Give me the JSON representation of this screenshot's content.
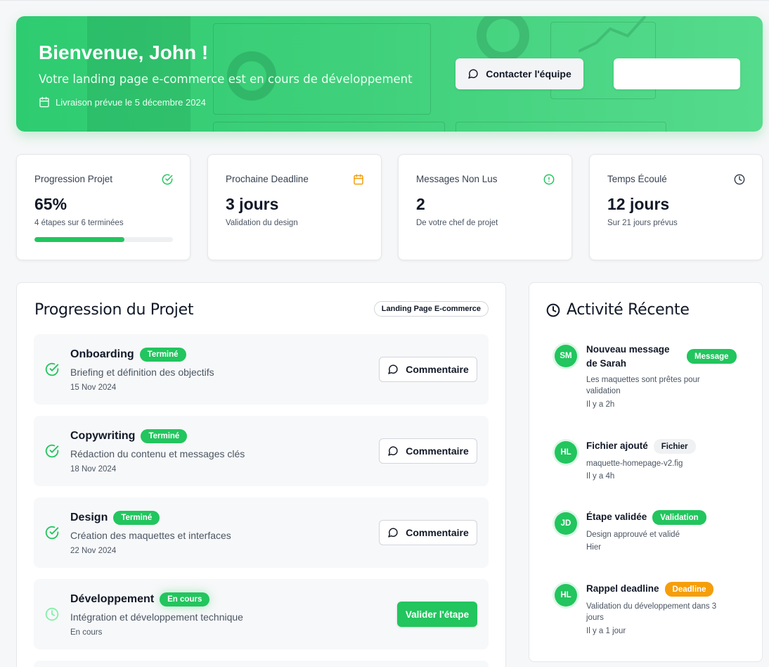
{
  "hero": {
    "title": "Bienvenue, John !",
    "subtitle": "Votre landing page e-commerce est en cours de développement",
    "delivery": "Livraison prévue le 5 décembre 2024",
    "contact_label": "Contacter l'équipe",
    "secondary_label": ""
  },
  "stats": [
    {
      "title": "Progression Projet",
      "value": "65%",
      "desc": "4 étapes sur 6 terminées",
      "icon": "check-circle-icon",
      "color": "#22c55e",
      "progress": 0.65
    },
    {
      "title": "Prochaine Deadline",
      "value": "3 jours",
      "desc": "Validation du design",
      "icon": "calendar-icon",
      "color": "#f59e0b"
    },
    {
      "title": "Messages Non Lus",
      "value": "2",
      "desc": "De votre chef de projet",
      "icon": "alert-circle-icon",
      "color": "#22c55e"
    },
    {
      "title": "Temps Écoulé",
      "value": "12 jours",
      "desc": "Sur 21 jours prévus",
      "icon": "clock-icon",
      "color": "#374151"
    }
  ],
  "project": {
    "title": "Progression du Projet",
    "tag": "Landing Page E-commerce",
    "steps": [
      {
        "name": "Onboarding",
        "status": "Terminé",
        "desc": "Briefing et définition des objectifs",
        "date": "15 Nov 2024",
        "action": "Commentaire"
      },
      {
        "name": "Copywriting",
        "status": "Terminé",
        "desc": "Rédaction du contenu et messages clés",
        "date": "18 Nov 2024",
        "action": "Commentaire"
      },
      {
        "name": "Design",
        "status": "Terminé",
        "desc": "Création des maquettes et interfaces",
        "date": "22 Nov 2024",
        "action": "Commentaire"
      },
      {
        "name": "Développement",
        "status": "En cours",
        "desc": "Intégration et développement technique",
        "date": "En cours",
        "action": "Valider l'étape"
      }
    ]
  },
  "activity": {
    "title": "Activité Récente",
    "items": [
      {
        "initials": "SM",
        "title": "Nouveau message de Sarah",
        "badge": "Message",
        "desc": "Les maquettes sont prêtes pour validation",
        "time": "Il y a 2h"
      },
      {
        "initials": "HL",
        "title": "Fichier ajouté",
        "badge": "Fichier",
        "desc": "maquette-homepage-v2.fig",
        "time": "Il y a 4h"
      },
      {
        "initials": "JD",
        "title": "Étape validée",
        "badge": "Validation",
        "desc": "Design approuvé et validé",
        "time": "Hier"
      },
      {
        "initials": "HL",
        "title": "Rappel deadline",
        "badge": "Deadline",
        "desc": "Validation du développement dans 3 jours",
        "time": "Il y a 1 jour"
      }
    ]
  },
  "colors": {
    "accent": "#22c55e",
    "warning": "#f59e0b"
  }
}
